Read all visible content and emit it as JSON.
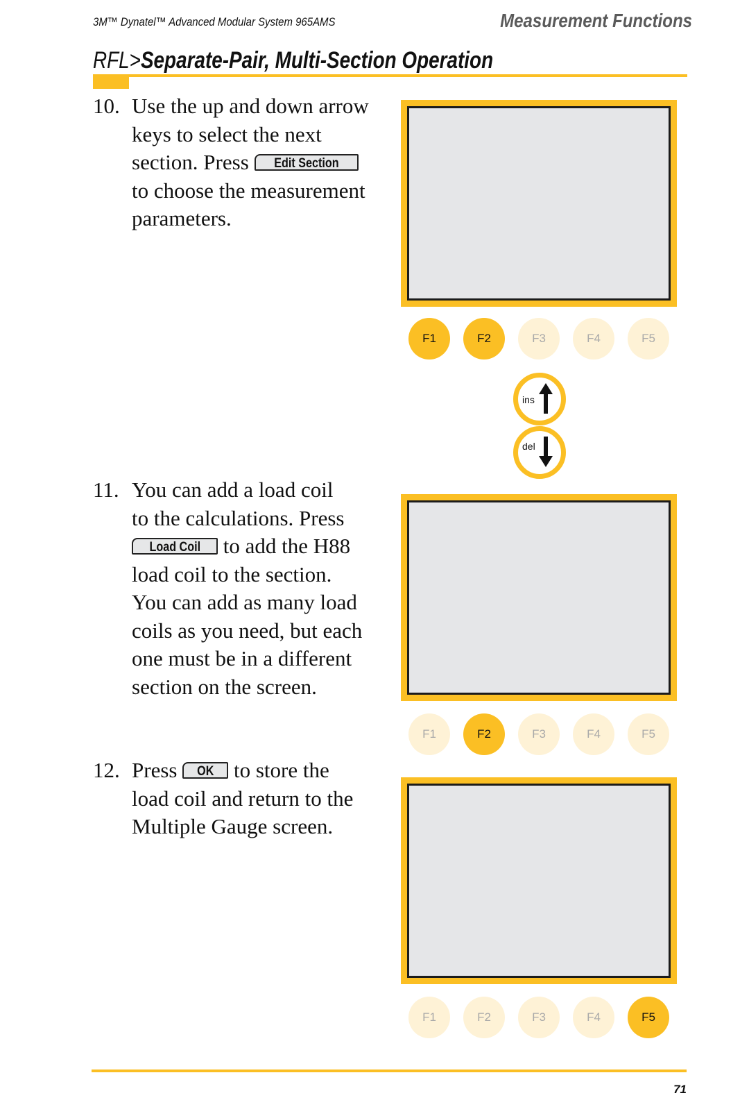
{
  "header": {
    "product": "3M™ Dynatel™ Advanced Modular System 965AMS",
    "section": "Measurement Functions"
  },
  "title": {
    "prefix": "RFL>",
    "main": "Separate-Pair, Multi-Section Operation"
  },
  "steps": [
    {
      "number": "10.",
      "lines": [
        "Use the up and down arrow",
        "keys to select the next",
        "section. Press",
        "to choose the measurement",
        "parameters."
      ],
      "softkey": "Edit Section"
    },
    {
      "number": "11.",
      "lines": [
        "You can add a load coil",
        "to the calculations. Press",
        "to add the H88",
        "load coil to the section.",
        "You can add as many load",
        "coils as you need, but each",
        "one must be in a different",
        "section on the screen."
      ],
      "softkey": "Load Coil"
    },
    {
      "number": "12.",
      "lines": [
        "Press",
        "to store the",
        "load coil and return to the",
        "Multiple Gauge screen."
      ],
      "softkey": "OK"
    }
  ],
  "keypads": [
    {
      "keys": [
        {
          "label": "F1",
          "active": true
        },
        {
          "label": "F2",
          "active": true
        },
        {
          "label": "F3",
          "active": false
        },
        {
          "label": "F4",
          "active": false
        },
        {
          "label": "F5",
          "active": false
        }
      ]
    },
    {
      "keys": [
        {
          "label": "F1",
          "active": false
        },
        {
          "label": "F2",
          "active": true
        },
        {
          "label": "F3",
          "active": false
        },
        {
          "label": "F4",
          "active": false
        },
        {
          "label": "F5",
          "active": false
        }
      ]
    },
    {
      "keys": [
        {
          "label": "F1",
          "active": false
        },
        {
          "label": "F2",
          "active": false
        },
        {
          "label": "F3",
          "active": false
        },
        {
          "label": "F4",
          "active": false
        },
        {
          "label": "F5",
          "active": true
        }
      ]
    }
  ],
  "arrow_keys": {
    "up_label": "ins",
    "down_label": "del"
  },
  "colors": {
    "accent": "#fbbf24",
    "key_inactive": "#fef2d6",
    "lcd": "#e5e6e8"
  },
  "footer": {
    "page_number": "71"
  }
}
